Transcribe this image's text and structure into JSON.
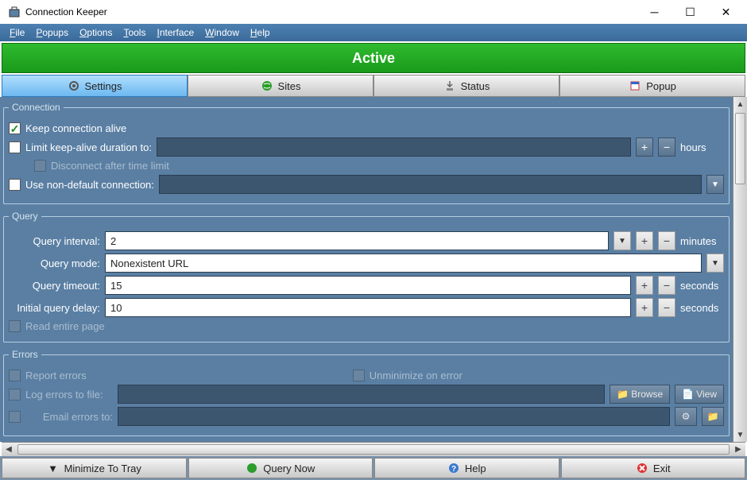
{
  "window": {
    "title": "Connection Keeper"
  },
  "menu": {
    "file": "File",
    "popups": "Popups",
    "options": "Options",
    "tools": "Tools",
    "interface": "Interface",
    "window": "Window",
    "help": "Help"
  },
  "status": "Active",
  "tabs": {
    "settings": "Settings",
    "sites": "Sites",
    "status": "Status",
    "popup": "Popup"
  },
  "connection": {
    "legend": "Connection",
    "keep_alive": "Keep connection alive",
    "limit_duration": "Limit keep-alive duration to:",
    "duration_value": "",
    "hours": "hours",
    "disconnect_after": "Disconnect after time limit",
    "use_non_default": "Use non-default connection:",
    "non_default_value": ""
  },
  "query": {
    "legend": "Query",
    "interval_label": "Query interval:",
    "interval_value": "2",
    "minutes": "minutes",
    "mode_label": "Query mode:",
    "mode_value": "Nonexistent URL",
    "timeout_label": "Query timeout:",
    "timeout_value": "15",
    "seconds": "seconds",
    "delay_label": "Initial query delay:",
    "delay_value": "10",
    "read_entire": "Read entire page"
  },
  "errors": {
    "legend": "Errors",
    "report": "Report errors",
    "unminimize": "Unminimize on error",
    "log_to_file": "Log errors to file:",
    "log_path": "",
    "browse": "Browse",
    "view": "View",
    "email_to": "Email errors to:",
    "email_value": ""
  },
  "buttons": {
    "minimize": "Minimize To Tray",
    "query_now": "Query Now",
    "help": "Help",
    "exit": "Exit"
  }
}
